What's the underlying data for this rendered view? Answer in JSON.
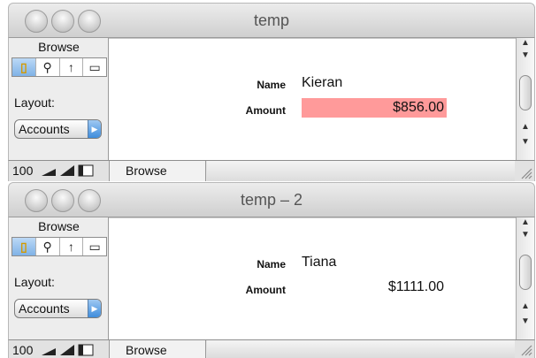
{
  "windows": [
    {
      "title": "temp",
      "sidebar": {
        "mode_label": "Browse",
        "tools": [
          "browse-tool-icon",
          "find-tool-icon",
          "layout-tool-icon",
          "preview-tool-icon"
        ],
        "layout_label": "Layout:",
        "layout_value": "Accounts"
      },
      "record": {
        "name_label": "Name",
        "name_value": "Kieran",
        "amount_label": "Amount",
        "amount_value": "$856.00",
        "amount_highlight_color": "#ff9a9a"
      },
      "status": {
        "zoom": "100",
        "mode": "Browse"
      }
    },
    {
      "title": "temp – 2",
      "sidebar": {
        "mode_label": "Browse",
        "tools": [
          "browse-tool-icon",
          "find-tool-icon",
          "layout-tool-icon",
          "preview-tool-icon"
        ],
        "layout_label": "Layout:",
        "layout_value": "Accounts"
      },
      "record": {
        "name_label": "Name",
        "name_value": "Tiana",
        "amount_label": "Amount",
        "amount_value": "$1111.00"
      },
      "status": {
        "zoom": "100",
        "mode": "Browse"
      }
    }
  ]
}
